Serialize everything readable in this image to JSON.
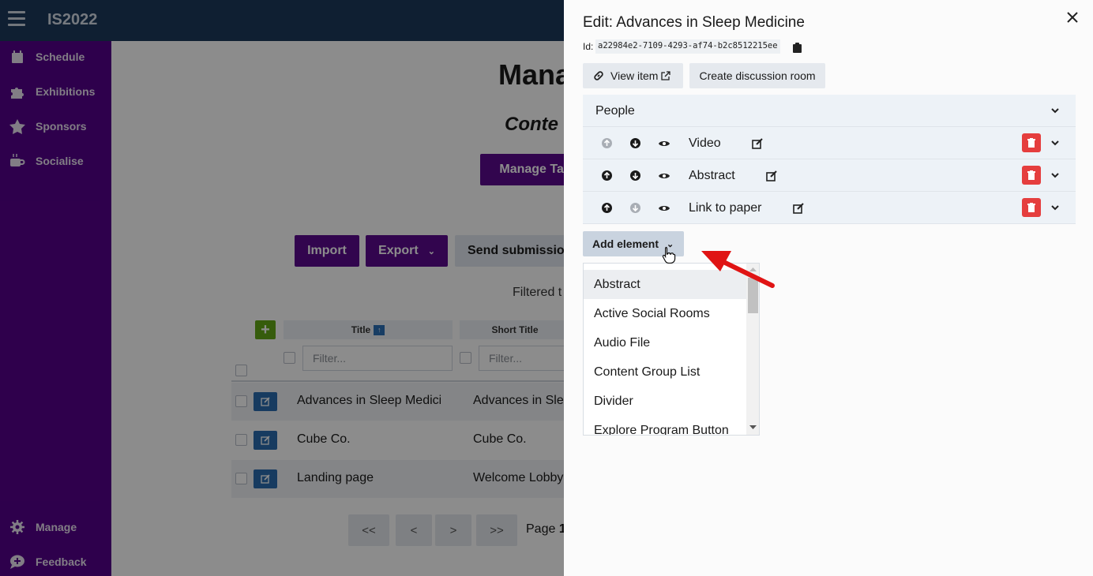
{
  "topbar": {
    "title": "IS2022"
  },
  "sidebar": {
    "items": [
      {
        "label": "Schedule",
        "icon": "calendar-icon"
      },
      {
        "label": "Exhibitions",
        "icon": "puzzle-icon"
      },
      {
        "label": "Sponsors",
        "icon": "star-icon"
      },
      {
        "label": "Socialise",
        "icon": "coffee-icon"
      }
    ],
    "bottom": [
      {
        "label": "Manage",
        "icon": "gear-icon"
      },
      {
        "label": "Feedback",
        "icon": "comment-plus-icon"
      }
    ]
  },
  "main": {
    "heading": "Mana",
    "subheading": "Conte",
    "manage_tags_label": "Manage Tag",
    "import_label": "Import",
    "export_label": "Export",
    "send_label": "Send submission",
    "filtered_text": "Filtered t",
    "table": {
      "headers": {
        "title": "Title",
        "short_title": "Short Title"
      },
      "sort_badge": "↑",
      "filter_placeholder": "Filter...",
      "rows": [
        {
          "title": "Advances in Sleep Medicine",
          "short": "Advances in Slee"
        },
        {
          "title": "Cube Co.",
          "short": "Cube Co."
        },
        {
          "title": "Landing page",
          "short": "Welcome Lobby"
        }
      ]
    },
    "pager": {
      "first": "<<",
      "prev": "<",
      "next": ">",
      "last": ">>",
      "page_text": "Page",
      "page_number": "1"
    }
  },
  "drawer": {
    "title": "Edit: Advances in Sleep Medicine",
    "id_label": "Id:",
    "id_value": "a22984e2-7109-4293-af74-b2c8512215ee",
    "view_item_label": "View item",
    "create_room_label": "Create discussion room",
    "accordion": {
      "people_label": "People",
      "elements": [
        {
          "label": "Video",
          "up_enabled": false,
          "down_enabled": true
        },
        {
          "label": "Abstract",
          "up_enabled": true,
          "down_enabled": true
        },
        {
          "label": "Link to paper",
          "up_enabled": true,
          "down_enabled": false
        }
      ]
    },
    "add_element_label": "Add element",
    "element_options": [
      "Abstract",
      "Active Social Rooms",
      "Audio File",
      "Content Group List",
      "Divider",
      "Explore Program Button"
    ],
    "selected_option": "Abstract"
  },
  "colors": {
    "topbar": "#1d3a5c",
    "sidebar": "#55008a",
    "primary_button": "#5c0a8e",
    "danger": "#e53e3e",
    "annotation_arrow": "#e01414"
  }
}
